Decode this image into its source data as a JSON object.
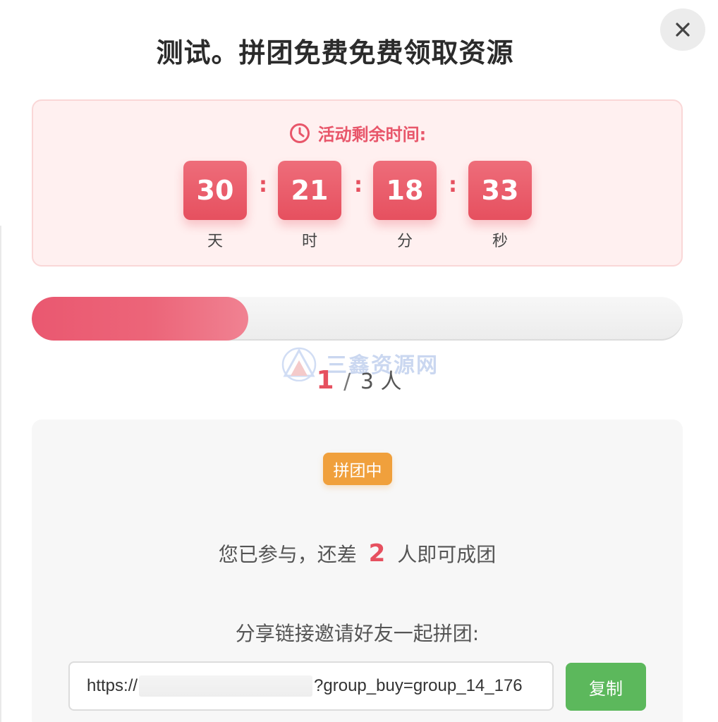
{
  "modal": {
    "title": "测试。拼团免费免费领取资源",
    "close_icon": "close-icon"
  },
  "countdown": {
    "label": "活动剩余时间:",
    "icon": "clock-icon",
    "separator": ":",
    "units": [
      {
        "value": "30",
        "label": "天"
      },
      {
        "value": "21",
        "label": "时"
      },
      {
        "value": "18",
        "label": "分"
      },
      {
        "value": "33",
        "label": "秒"
      }
    ]
  },
  "progress": {
    "joined": 1,
    "total": 3,
    "joined_text": "1",
    "slash": "/",
    "total_text": "3",
    "unit": "人",
    "fraction": 0.333
  },
  "watermark": {
    "text": "三鑫资源网",
    "logo_icon": "mountain-logo-icon"
  },
  "group": {
    "status_badge": "拼团中",
    "joined_prefix": "您已参与，还差",
    "remaining": "2",
    "joined_suffix": "人即可成团",
    "share_label": "分享链接邀请好友一起拼团:",
    "link_prefix": "https://",
    "link_suffix": "?group_buy=group_14_176",
    "copy_label": "复制"
  },
  "colors": {
    "accent_red": "#e6505f",
    "badge_orange": "#f0a03c",
    "copy_green": "#5cb85c",
    "countdown_bg": "#fff0f0"
  }
}
